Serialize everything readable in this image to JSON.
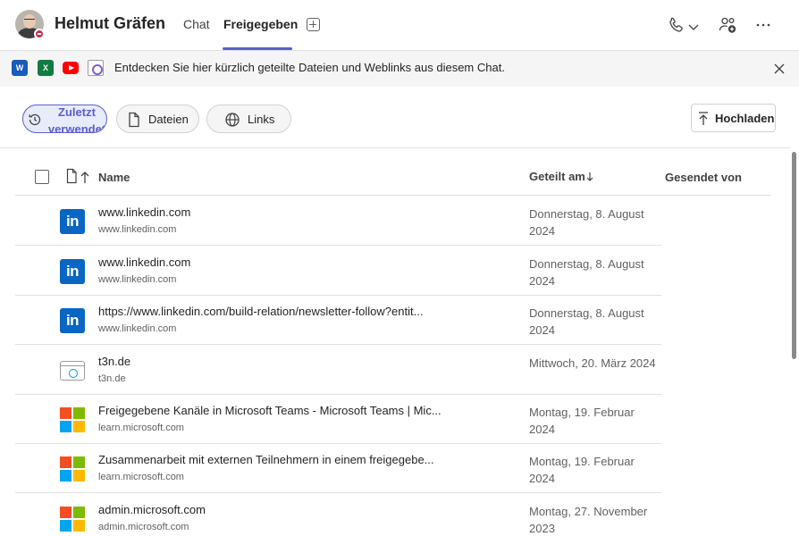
{
  "header": {
    "chat_name": "Helmut Gräfen",
    "tabs": [
      {
        "label": "Chat"
      },
      {
        "label": "Freigegeben"
      }
    ],
    "icons": [
      "call-icon",
      "chevron-down-icon",
      "add-people-icon",
      "more-icon"
    ],
    "accent_color": "#5b5fc7"
  },
  "banner": {
    "text": "Entdecken Sie hier kürzlich geteilte Dateien und Weblinks aus diesem Chat.",
    "app_icons": [
      "word-icon",
      "excel-icon",
      "youtube-icon",
      "loop-icon"
    ],
    "word_letter": "W",
    "excel_letter": "X"
  },
  "filters": {
    "recent": "Zuletzt verwendet",
    "files": "Dateien",
    "links": "Links",
    "upload": "Hochladen"
  },
  "table": {
    "columns": {
      "name": "Name",
      "shared_on": "Geteilt am",
      "sent_by": "Gesendet von"
    },
    "rows": [
      {
        "icon": "linkedin",
        "title": "www.linkedin.com",
        "domain": "www.linkedin.com",
        "date": "Donnerstag, 8. August 2024"
      },
      {
        "icon": "linkedin",
        "title": "www.linkedin.com",
        "domain": "www.linkedin.com",
        "date": "Donnerstag, 8. August 2024"
      },
      {
        "icon": "linkedin",
        "title": "https://www.linkedin.com/build-relation/newsletter-follow?entit...",
        "domain": "www.linkedin.com",
        "date": "Donnerstag, 8. August 2024"
      },
      {
        "icon": "web",
        "title": "t3n.de",
        "domain": "t3n.de",
        "date": "Mittwoch, 20. März 2024"
      },
      {
        "icon": "microsoft",
        "title": "Freigegebene Kanäle in Microsoft Teams - Microsoft Teams | Mic...",
        "domain": "learn.microsoft.com",
        "date": "Montag, 19. Februar 2024"
      },
      {
        "icon": "microsoft",
        "title": "Zusammenarbeit mit externen Teilnehmern in einem freigegebe...",
        "domain": "learn.microsoft.com",
        "date": "Montag, 19. Februar 2024"
      },
      {
        "icon": "microsoft",
        "title": "admin.microsoft.com",
        "domain": "admin.microsoft.com",
        "date": "Montag, 27. November 2023"
      }
    ],
    "linkedin_mark": "in"
  }
}
